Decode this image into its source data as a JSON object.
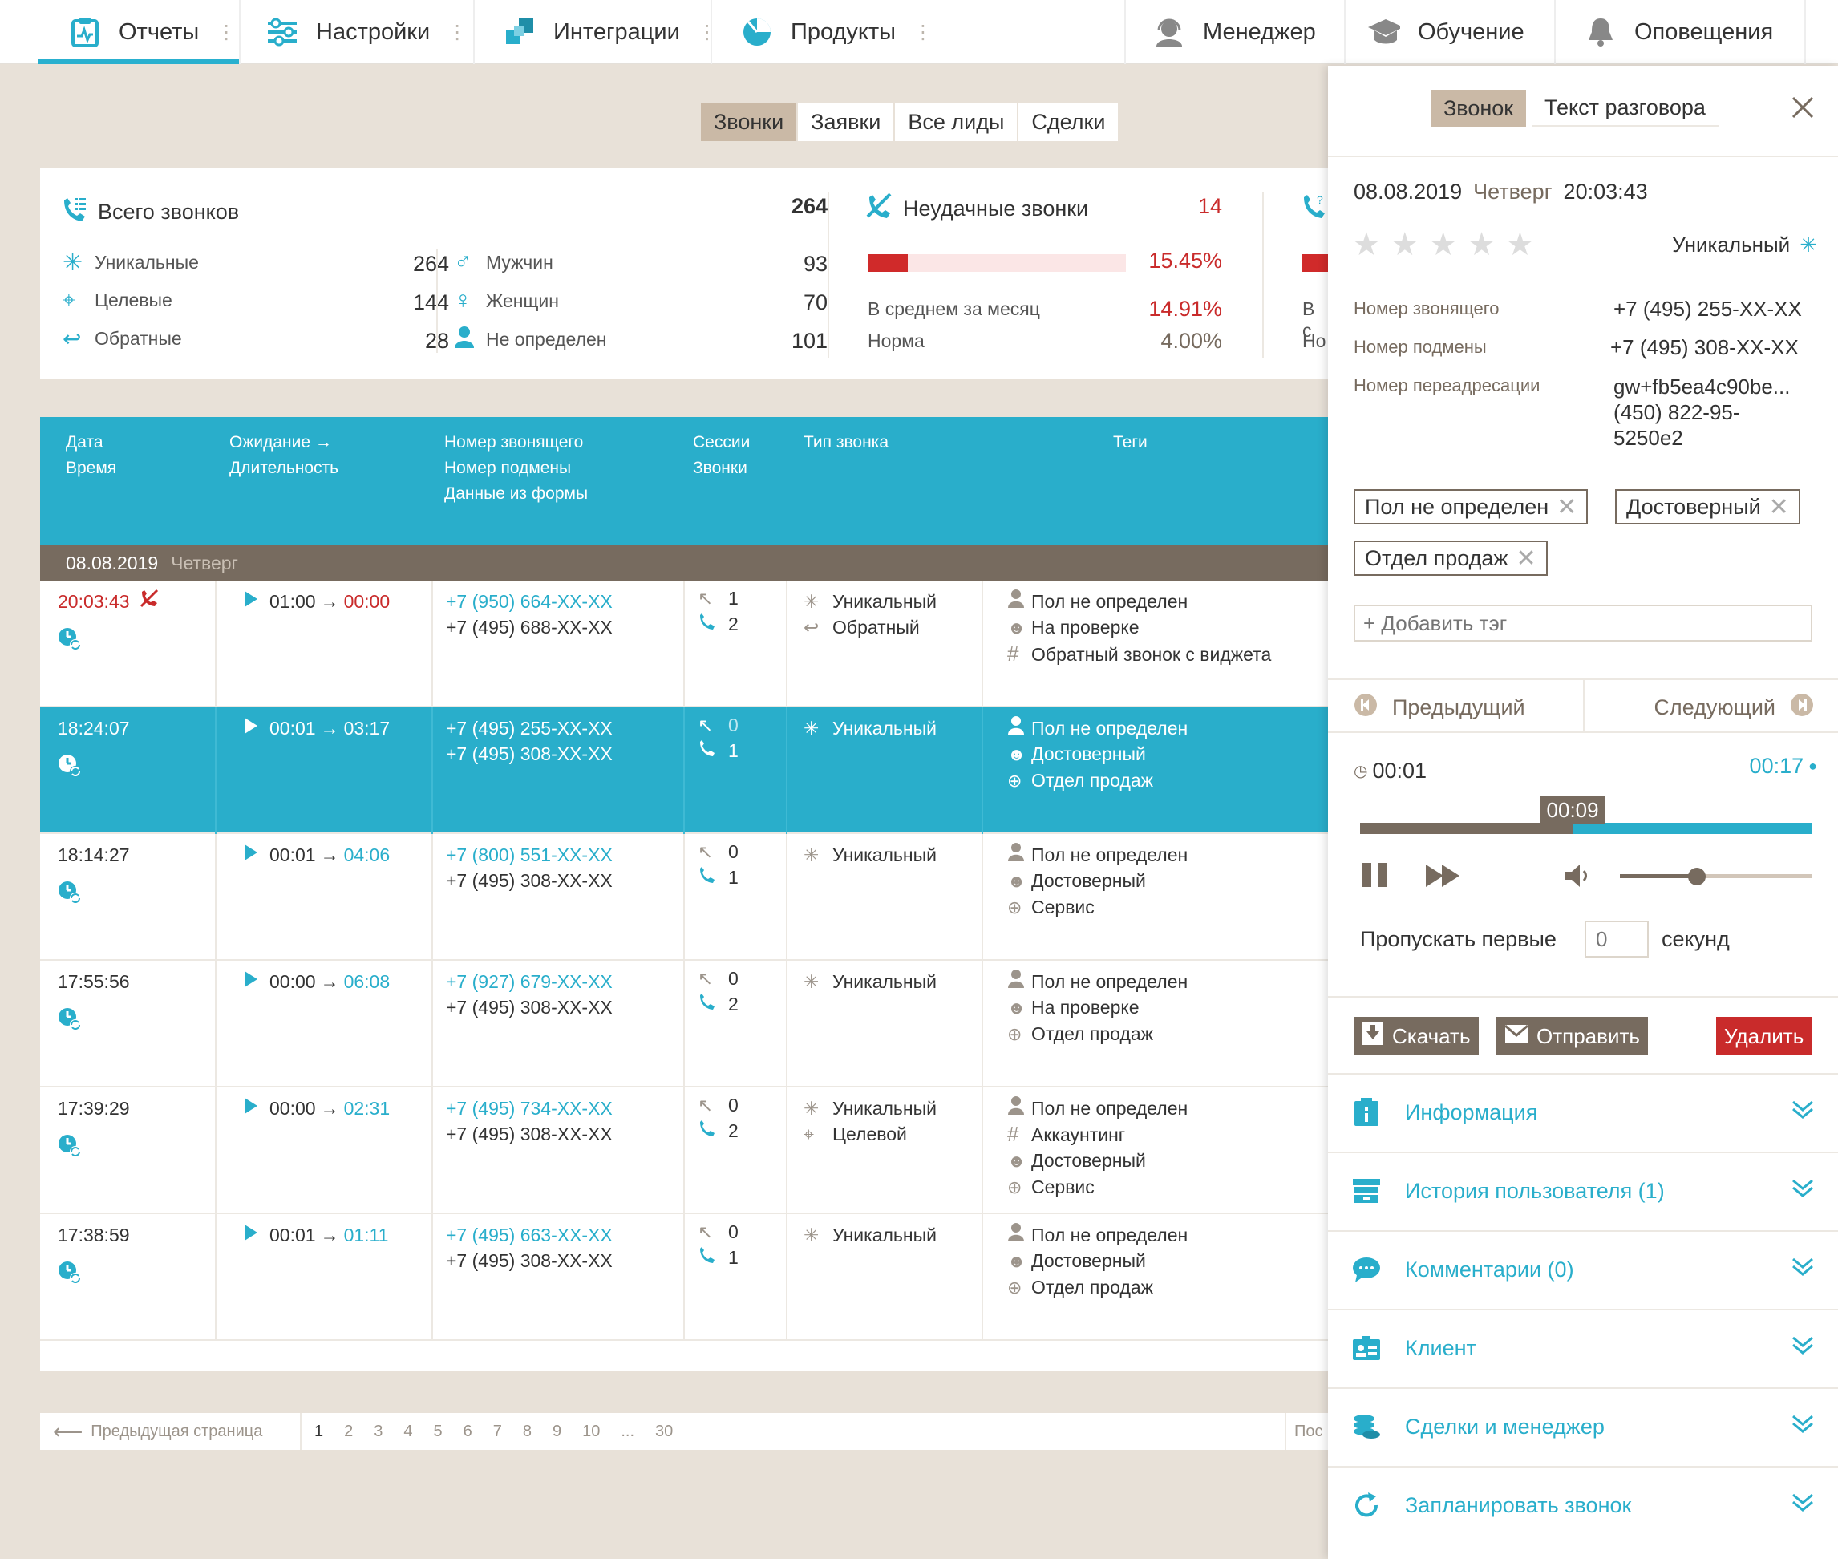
{
  "nav": {
    "items": [
      {
        "label": "Отчеты"
      },
      {
        "label": "Настройки"
      },
      {
        "label": "Интеграции"
      },
      {
        "label": "Продукты"
      }
    ],
    "right": [
      {
        "label": "Менеджер"
      },
      {
        "label": "Обучение"
      },
      {
        "label": "Оповещения"
      }
    ],
    "dots": "⋮"
  },
  "tabs": [
    "Звонки",
    "Заявки",
    "Все лиды",
    "Сделки"
  ],
  "stats": {
    "total_label": "Всего звонков",
    "total": "264",
    "unique_label": "Уникальные",
    "unique": "264",
    "target_label": "Целевые",
    "target": "144",
    "back_label": "Обратные",
    "back": "28",
    "male_label": "Мужчин",
    "male": "93",
    "female_label": "Женщин",
    "female": "70",
    "undef_label": "Не определен",
    "undef": "101",
    "failed_label": "Неудачные звонки",
    "failed": "14",
    "failed_pct": "15.45%",
    "failed_fraction": 0.1545,
    "avg_label": "В среднем за месяц",
    "avg": "14.91%",
    "norm_label": "Норма",
    "norm": "4.00%",
    "cut_avg": "В с",
    "cut_norm": "Но"
  },
  "table": {
    "headers": {
      "date": "Дата",
      "time": "Время",
      "wait": "Ожидание →",
      "dur": "Длительность",
      "caller": "Номер звонящего",
      "sub": "Номер подмены",
      "form": "Данные из формы",
      "sess": "Сессии",
      "calls": "Звонки",
      "type": "Тип звонка",
      "tags": "Теги"
    },
    "group_date": "08.08.2019",
    "group_day": "Четверг",
    "rows": [
      {
        "time": "20:03:43",
        "wait": "01:00",
        "dur": "00:00",
        "caller": "+7 (950) 664-XX-XX",
        "sub": "+7 (495) 688-XX-XX",
        "s1": "1",
        "s2": "2",
        "t1": "Уникальный",
        "t2": "Обратный",
        "g1": "Пол не определен",
        "g2": "На проверке",
        "g3": "Обратный звонок с виджета",
        "g4": ""
      },
      {
        "time": "18:24:07",
        "wait": "00:01",
        "dur": "03:17",
        "caller": "+7 (495) 255-XX-XX",
        "sub": "+7 (495) 308-XX-XX",
        "s1": "0",
        "s2": "1",
        "t1": "Уникальный",
        "t2": "",
        "g1": "Пол не определен",
        "g2": "Достоверный",
        "g3": "Отдел продаж",
        "g4": ""
      },
      {
        "time": "18:14:27",
        "wait": "00:01",
        "dur": "04:06",
        "caller": "+7 (800) 551-XX-XX",
        "sub": "+7 (495) 308-XX-XX",
        "s1": "0",
        "s2": "1",
        "t1": "Уникальный",
        "t2": "",
        "g1": "Пол не определен",
        "g2": "Достоверный",
        "g3": "Сервис",
        "g4": ""
      },
      {
        "time": "17:55:56",
        "wait": "00:00",
        "dur": "06:08",
        "caller": "+7 (927) 679-XX-XX",
        "sub": "+7 (495) 308-XX-XX",
        "s1": "0",
        "s2": "2",
        "t1": "Уникальный",
        "t2": "",
        "g1": "Пол не определен",
        "g2": "На проверке",
        "g3": "Отдел продаж",
        "g4": ""
      },
      {
        "time": "17:39:29",
        "wait": "00:00",
        "dur": "02:31",
        "caller": "+7 (495) 734-XX-XX",
        "sub": "+7 (495) 308-XX-XX",
        "s1": "0",
        "s2": "2",
        "t1": "Уникальный",
        "t2": "Целевой",
        "g1": "Пол не определен",
        "g2": "Аккаунтинг",
        "g3": "Достоверный",
        "g4": "Сервис"
      },
      {
        "time": "17:38:59",
        "wait": "00:01",
        "dur": "01:11",
        "caller": "+7 (495) 663-XX-XX",
        "sub": "+7 (495) 308-XX-XX",
        "s1": "0",
        "s2": "1",
        "t1": "Уникальный",
        "t2": "",
        "g1": "Пол не определен",
        "g2": "Достоверный",
        "g3": "Отдел продаж",
        "g4": ""
      }
    ]
  },
  "pager": {
    "prev": "Предыдущая страница",
    "pages": [
      "1",
      "2",
      "3",
      "4",
      "5",
      "6",
      "7",
      "8",
      "9",
      "10",
      "...",
      "30"
    ],
    "next_cut": "Пос"
  },
  "panel": {
    "tab_call": "Звонок",
    "tab_text": "Текст разговора",
    "date": "08.08.2019",
    "day": "Четверг",
    "time": "20:03:43",
    "unique": "Уникальный",
    "stars": "★★★★★",
    "caller_label": "Номер звонящего",
    "caller": "+7 (495) 255-XX-XX",
    "sub_label": "Номер подмены",
    "sub": "+7 (495) 308-XX-XX",
    "redirect_label": "Номер переадресации",
    "redirect1": "gw+fb5ea4c90be...",
    "redirect2": "(450) 822-95-",
    "redirect3": "5250e2",
    "tags": [
      "Пол не определен",
      "Достоверный",
      "Отдел продаж"
    ],
    "add_tag_placeholder": "+ Добавить тэг",
    "prev": "Предыдущий",
    "next": "Следующий",
    "pos": "00:01",
    "total": "00:17",
    "marker": "00:09",
    "progress": 0.47,
    "volume": 0.4,
    "skip_label": "Пропускать первые",
    "skip_value": "0",
    "skip_unit": "секунд",
    "download": "Скачать",
    "send": "Отправить",
    "delete": "Удалить",
    "accordion": [
      "Информация",
      "История пользователя (1)",
      "Комментарии (0)",
      "Клиент",
      "Сделки и менеджер",
      "Запланировать звонок"
    ]
  }
}
